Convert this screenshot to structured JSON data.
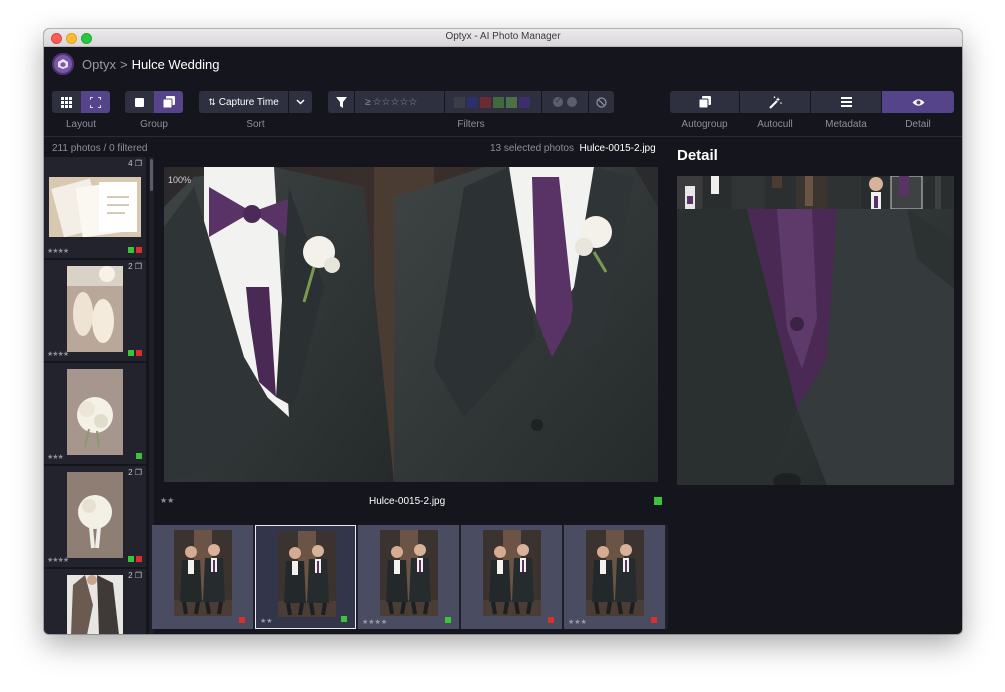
{
  "window": {
    "title": "Optyx - AI Photo Manager"
  },
  "breadcrumb": {
    "app": "Optyx",
    "separator": ">",
    "current": "Hulce Wedding"
  },
  "toolbar": {
    "layout_label": "Layout",
    "group_label": "Group",
    "sort_label": "Sort",
    "sort_value": "Capture Time",
    "filters_label": "Filters",
    "rating_filter_symbol": "≥",
    "autogroup_label": "Autogroup",
    "autocull_label": "Autocull",
    "metadata_label": "Metadata",
    "detail_label": "Detail",
    "filter_colors": [
      "#3b3d48",
      "#2b2f6a",
      "#6b2b32",
      "#3f6a3a",
      "#4e7048",
      "#3d2f6e"
    ]
  },
  "status": {
    "photo_count": "211 photos",
    "filtered": "0 filtered",
    "selected": "13 selected photos",
    "current_file": "Hulce-0015-2.jpg"
  },
  "sidebar": {
    "items": [
      {
        "count": "4",
        "stars": "★★★★",
        "tags": [
          "#3ac43a",
          "#d9302c"
        ],
        "thumb": "invitation"
      },
      {
        "count": "2",
        "stars": "★★★★",
        "tags": [
          "#3ac43a",
          "#d9302c"
        ],
        "thumb": "shoes"
      },
      {
        "count": "",
        "stars": "★★★",
        "tags": [
          "#3ac43a"
        ],
        "thumb": "bouquet"
      },
      {
        "count": "2",
        "stars": "★★★★",
        "tags": [
          "#3ac43a",
          "#d9302c"
        ],
        "thumb": "bouquet2"
      },
      {
        "count": "2",
        "stars": "",
        "tags": [],
        "thumb": "dress"
      }
    ]
  },
  "main": {
    "zoom": "100%",
    "stars": "★★",
    "filename": "Hulce-0015-2.jpg",
    "tag_color": "#3ac43a"
  },
  "filmstrip": {
    "items": [
      {
        "stars": "",
        "tag": "#d9302c",
        "selected": false
      },
      {
        "stars": "★★",
        "tag": "#3ac43a",
        "selected": true
      },
      {
        "stars": "★★★★",
        "tag": "#3ac43a",
        "selected": false
      },
      {
        "stars": "",
        "tag": "#d9302c",
        "selected": false
      },
      {
        "stars": "★★★",
        "tag": "#d9302c",
        "selected": false
      }
    ]
  },
  "detail": {
    "title": "Detail"
  }
}
